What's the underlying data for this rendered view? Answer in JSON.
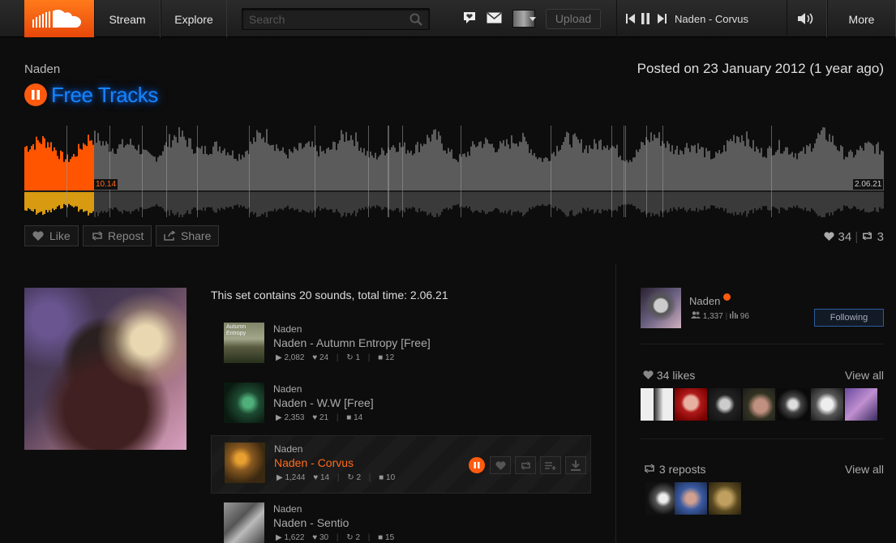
{
  "header": {
    "nav": [
      {
        "label": "Stream"
      },
      {
        "label": "Explore"
      }
    ],
    "search_placeholder": "Search",
    "upload_label": "Upload",
    "now_playing": "Naden - Corvus",
    "more_label": "More"
  },
  "set": {
    "artist": "Naden",
    "title": "Free Tracks",
    "posted": "Posted on 23 January 2012 (1 year ago)",
    "current_time": "10.14",
    "total_time": "2.06.21",
    "progress_fraction": 0.08,
    "actions": {
      "like": "Like",
      "repost": "Repost",
      "share": "Share"
    },
    "likes": "34",
    "reposts": "3",
    "summary": "This set contains 20 sounds, total time: 2.06.21"
  },
  "tracks": [
    {
      "artist": "Naden",
      "title": "Naden - Autumn Entropy [Free]",
      "plays": "2,082",
      "likes": "24",
      "reposts": "1",
      "comments": "12",
      "thumb_text": "Autumn Entropy",
      "active": false
    },
    {
      "artist": "Naden",
      "title": "Naden - W.W [Free]",
      "plays": "2,353",
      "likes": "21",
      "reposts": "",
      "comments": "14",
      "active": false
    },
    {
      "artist": "Naden",
      "title": "Naden - Corvus",
      "plays": "1,244",
      "likes": "14",
      "reposts": "2",
      "comments": "10",
      "active": true
    },
    {
      "artist": "Naden",
      "title": "Naden - Sentio",
      "plays": "1,622",
      "likes": "30",
      "reposts": "2",
      "comments": "15",
      "active": false
    }
  ],
  "sidebar": {
    "user": {
      "name": "Naden",
      "followers": "1,337",
      "tracks": "96",
      "follow_state": "Following"
    },
    "likes_heading": "34 likes",
    "reposts_heading": "3 reposts",
    "view_all": "View all"
  },
  "colors": {
    "accent": "#ff5a0e",
    "title_glow": "#1784ff",
    "background": "#0d0d0d"
  }
}
